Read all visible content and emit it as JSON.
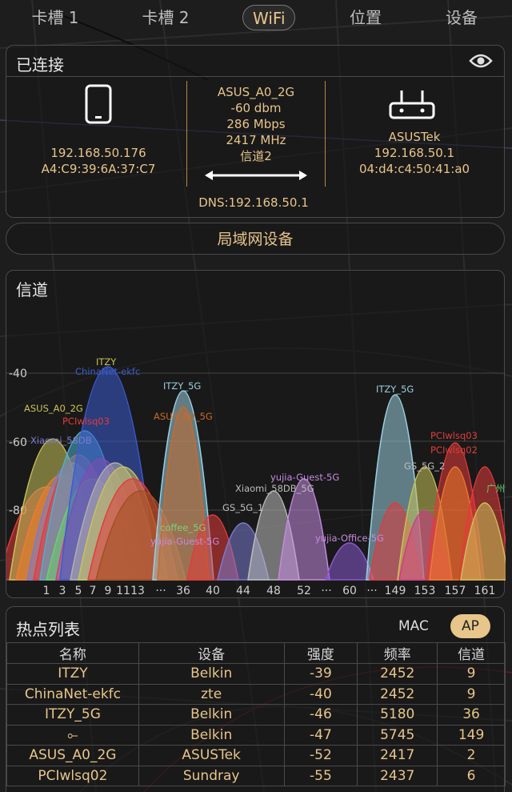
{
  "tabs": [
    {
      "label": "卡槽 1"
    },
    {
      "label": "卡槽 2"
    },
    {
      "label": "WiFi"
    },
    {
      "label": "位置"
    },
    {
      "label": "设备"
    }
  ],
  "connected": {
    "title": "已连接",
    "device_ip": "192.168.50.176",
    "device_mac": "A4:C9:39:6A:37:C7",
    "ssid": "ASUS_A0_2G",
    "signal": "-60 dbm",
    "speed": "286 Mbps",
    "freq": "2417 MHz",
    "channel": "信道2",
    "dns": "DNS:192.168.50.1",
    "router_name": "ASUSTek",
    "router_ip": "192.168.50.1",
    "router_mac": "04:d4:c4:50:41:a0"
  },
  "lan_button": "局域网设备",
  "channel_panel": {
    "title": "信道",
    "y_ticks": [
      "-40",
      "-60",
      "-80"
    ],
    "x_ticks": [
      "1",
      "3",
      "5",
      "7",
      "9",
      "11",
      "13",
      "···",
      "36",
      "40",
      "44",
      "48",
      "52",
      "···",
      "60",
      "···",
      "149",
      "153",
      "157",
      "161"
    ],
    "peak_labels": [
      {
        "text": "ITZY",
        "color": "#c9c35a"
      },
      {
        "text": "ChinaNet-ekfc",
        "color": "#3a5bd0"
      },
      {
        "text": "ASUS_A0_2G",
        "color": "#c9c35a"
      },
      {
        "text": "PCIwlsq03",
        "color": "#e23b3b"
      },
      {
        "text": "Xiaomi_58DB",
        "color": "#7a7ad0"
      },
      {
        "text": "ITZY_5G",
        "color": "#9ad0e0"
      },
      {
        "text": "ASUS_A0_5G",
        "color": "#c86a2a"
      },
      {
        "text": "ITZY_5G",
        "color": "#9ad0e0"
      },
      {
        "text": "PCIwlsq03",
        "color": "#e23b3b"
      },
      {
        "text": "PCIwlsq02",
        "color": "#e23b3b"
      },
      {
        "text": "GS_5G_2",
        "color": "#bdbdbd"
      },
      {
        "text": "yujia-Guest-5G",
        "color": "#c58ae0"
      },
      {
        "text": "Xiaomi_58DB_5G",
        "color": "#bdbdbd"
      },
      {
        "text": "GS_5G_1",
        "color": "#bdbdbd"
      },
      {
        "text": "coffee_5G",
        "color": "#7ad07a"
      },
      {
        "text": "yujia-Guest-5G",
        "color": "#c58ae0"
      },
      {
        "text": "yujia-Office-5G",
        "color": "#c58ae0"
      },
      {
        "text": "广州制信",
        "color": "#6ad06a"
      }
    ]
  },
  "hotspots": {
    "title": "热点列表",
    "mac_label": "MAC",
    "ap_label": "AP",
    "columns": [
      "名称",
      "设备",
      "强度",
      "频率",
      "信道"
    ],
    "rows": [
      [
        "ITZY",
        "Belkin",
        "-39",
        "2452",
        "9"
      ],
      [
        "ChinaNet-ekfc",
        "zte",
        "-40",
        "2452",
        "9"
      ],
      [
        "ITZY_5G",
        "Belkin",
        "-46",
        "5180",
        "36"
      ],
      [
        "⟜",
        "Belkin",
        "-47",
        "5745",
        "149"
      ],
      [
        "ASUS_A0_2G",
        "ASUSTek",
        "-52",
        "2417",
        "2"
      ],
      [
        "PCIwlsq02",
        "Sundray",
        "-55",
        "2437",
        "6"
      ]
    ]
  },
  "colors": {
    "accent": "#e8c58a",
    "background": "#1d1d1d",
    "border": "#4a4a4a"
  }
}
